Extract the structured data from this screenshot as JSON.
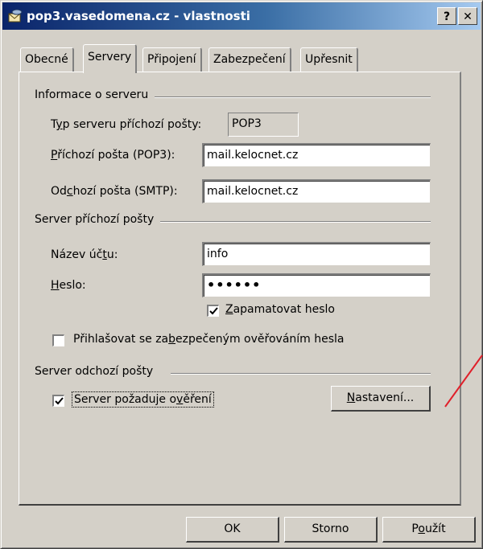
{
  "window": {
    "title": "pop3.vasedomena.cz - vlastnosti",
    "help_label": "?",
    "close_label": "✕"
  },
  "tabs": [
    {
      "label": "Obecné"
    },
    {
      "label": "Servery"
    },
    {
      "label": "Připojení"
    },
    {
      "label": "Zabezpečení"
    },
    {
      "label": "Upřesnit"
    }
  ],
  "server_info": {
    "group_label": "Informace o serveru",
    "type_label": {
      "pre": "T",
      "key": "y",
      "post": "p serveru příchozí pošty:"
    },
    "type_value": "POP3",
    "incoming_label": {
      "pre": "",
      "key": "P",
      "post": "říchozí pošta (POP3):"
    },
    "incoming_value": "mail.kelocnet.cz",
    "outgoing_label": {
      "pre": "Od",
      "key": "c",
      "post": "hozí pošta (SMTP):"
    },
    "outgoing_value": "mail.kelocnet.cz"
  },
  "incoming_server": {
    "group_label": "Server příchozí pošty",
    "account_label": {
      "pre": "Název úč",
      "key": "t",
      "post": "u:"
    },
    "account_value": "info",
    "password_label": {
      "pre": "",
      "key": "H",
      "post": "eslo:"
    },
    "password_value": "••••••",
    "remember_label": {
      "pre": "",
      "key": "Z",
      "post": "apamatovat heslo"
    },
    "remember_checked": true,
    "spa_label": {
      "pre": "Přihlašovat se za",
      "key": "b",
      "post": "ezpečeným ověřováním hesla"
    },
    "spa_checked": false
  },
  "outgoing_server": {
    "group_label": "Server odchozí pošty",
    "auth_label": {
      "pre": "Server požaduje o",
      "key": "v",
      "post": "ěření"
    },
    "auth_checked": true,
    "settings_button": {
      "pre": "",
      "key": "N",
      "post": "astavení..."
    }
  },
  "footer": {
    "ok_label": "OK",
    "cancel_label": "Storno",
    "apply_label": {
      "pre": "P",
      "key": "o",
      "post": "užít"
    }
  },
  "annotation": {
    "color": "#e0202a"
  }
}
